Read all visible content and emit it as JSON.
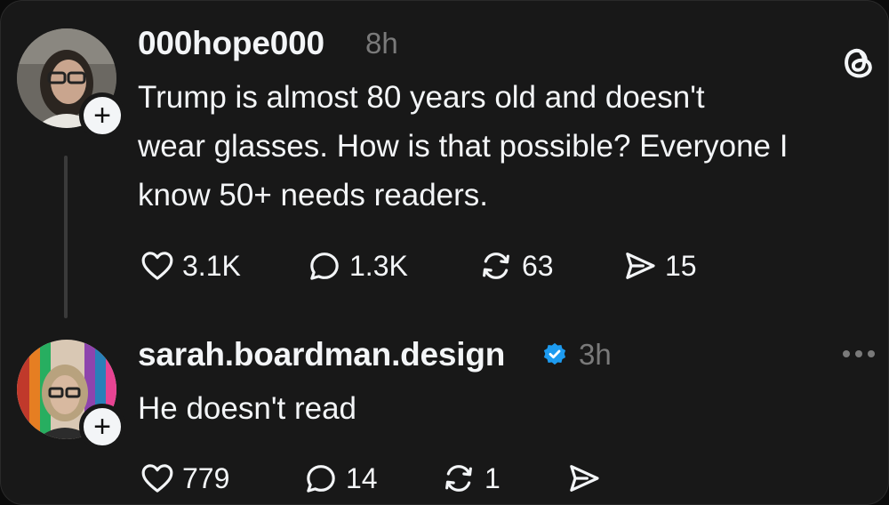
{
  "post": {
    "username": "000hope000",
    "time": "8h",
    "text_lines": [
      "Trump is almost 80 years old and doesn't",
      "wear glasses. How is that possible? Everyone I",
      "know 50+ needs readers."
    ],
    "likes": "3.1K",
    "replies": "1.3K",
    "reposts": "63",
    "shares": "15",
    "follow_label": "+"
  },
  "reply": {
    "username": "sarah.boardman.design",
    "time": "3h",
    "text": "He doesn't read",
    "likes": "779",
    "replies": "14",
    "reposts": "1",
    "follow_label": "+"
  },
  "icons": {
    "app": "threads-logo-icon",
    "more": "more-options-icon",
    "verified": "verified-badge-icon",
    "like": "heart-icon",
    "reply": "comment-icon",
    "repost": "repost-icon",
    "share": "send-icon"
  },
  "colors": {
    "background": "#181818",
    "text": "#f3f5f7",
    "muted": "#7a7a7a",
    "verified": "#1d9bf0"
  }
}
